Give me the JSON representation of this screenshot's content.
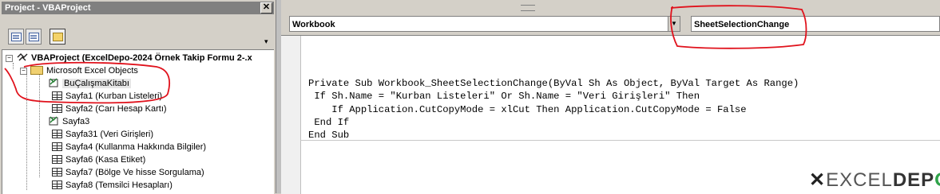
{
  "project_pane": {
    "title": "Project - VBAProject",
    "close_glyph": "✕",
    "toolbar": {
      "view_code_icon": "view-code-icon",
      "view_object_icon": "view-object-icon",
      "toggle_folders_icon": "toggle-folders-icon"
    },
    "tree": {
      "root_label": "VBAProject (ExcelDepo-2024 Örnek Takip Formu 2-.x",
      "folder_label": "Microsoft Excel Objects",
      "items": [
        {
          "label": "BuÇalışmaKitabı",
          "icon": "workbook-icon"
        },
        {
          "label": "Sayfa1 (Kurban Listeleri)",
          "icon": "sheet-icon"
        },
        {
          "label": "Sayfa2 (Carı Hesap Kartı)",
          "icon": "sheet-icon"
        },
        {
          "label": "Sayfa3",
          "icon": "workbook-icon"
        },
        {
          "label": "Sayfa31 (Veri Girişleri)",
          "icon": "sheet-icon"
        },
        {
          "label": "Sayfa4 (Kullanma Hakkında Bilgiler)",
          "icon": "sheet-icon"
        },
        {
          "label": "Sayfa6 (Kasa Etiket)",
          "icon": "sheet-icon"
        },
        {
          "label": "Sayfa7 (Bölge Ve hisse Sorgulama)",
          "icon": "sheet-icon"
        },
        {
          "label": "Sayfa8 (Temsilci Hesapları)",
          "icon": "sheet-icon"
        }
      ]
    }
  },
  "code_window": {
    "object_combo": "Workbook",
    "procedure_combo": "SheetSelectionChange",
    "code_lines": [
      "Private Sub Workbook_SheetSelectionChange(ByVal Sh As Object, ByVal Target As Range)",
      " If Sh.Name = \"Kurban Listeleri\" Or Sh.Name = \"Veri Girişleri\" Then",
      "    If Application.CutCopyMode = xlCut Then Application.CutCopyMode = False",
      " End If",
      "End Sub"
    ]
  },
  "watermark": {
    "part1": "EXCEL",
    "part2": "DEP",
    "part3": "O"
  },
  "colors": {
    "annotation_red": "#e0121c",
    "logo_green": "#2fa34a"
  }
}
